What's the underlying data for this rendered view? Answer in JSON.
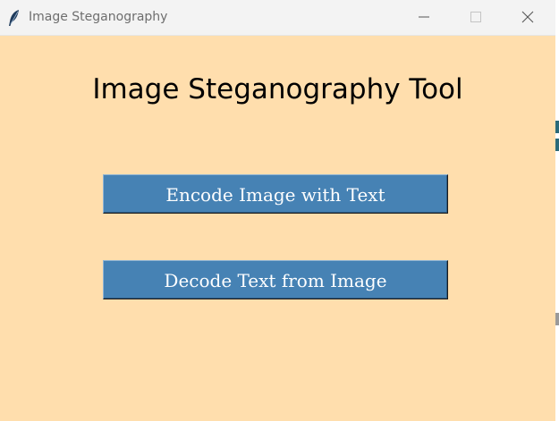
{
  "window": {
    "title": "Image Steganography",
    "icon": "feather-icon",
    "background": "#ffdead"
  },
  "main": {
    "heading": "Image Steganography Tool",
    "buttons": [
      {
        "label": "Encode Image with Text",
        "color": "#4682b4"
      },
      {
        "label": "Decode Text from Image",
        "color": "#4682b4"
      }
    ]
  }
}
